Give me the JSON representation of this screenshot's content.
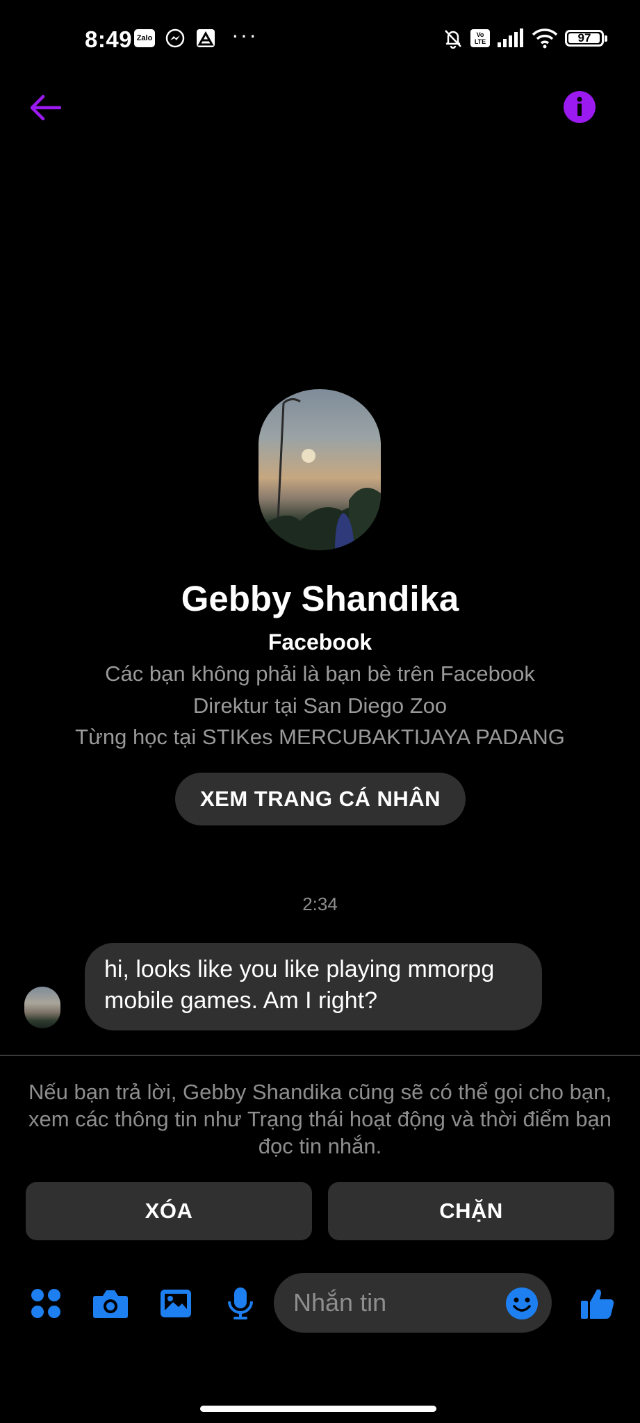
{
  "colors": {
    "accent_purple": "#9B1AF0",
    "accent_blue": "#1E7FF0",
    "bubble_bg": "#303030",
    "muted_text": "#8E8E8E"
  },
  "status_bar": {
    "time": "8:49",
    "left_icons": [
      "zalo-icon",
      "messenger-icon",
      "app-icon",
      "more-dots-icon"
    ],
    "zalo_text": "Zalo",
    "dots": "···",
    "right_icons": [
      "notifications-off-icon",
      "volte-icon",
      "signal-icon",
      "wifi-icon",
      "battery-icon"
    ],
    "volte_text": "Vo LTE",
    "battery": "97",
    "battery_level": 0.97
  },
  "nav": {
    "back_icon": "back-arrow-icon",
    "info_icon": "info-icon"
  },
  "profile": {
    "name": "Gebby Shandika",
    "source": "Facebook",
    "friend_status": "Các bạn không phải là bạn bè trên Facebook",
    "work": "Direktur tại San Diego Zoo",
    "education": "Từng học tại STIKes MERCUBAKTIJAYA PADANG",
    "view_profile_label": "XEM TRANG CÁ NHÂN"
  },
  "chat": {
    "timestamp": "2:34",
    "messages": [
      {
        "text": "hi, looks like you like playing mmorpg mobile games. Am I right?"
      }
    ]
  },
  "request": {
    "notice": "Nếu bạn trả lời, Gebby Shandika cũng sẽ có thể gọi cho bạn, xem các thông tin như Trạng thái hoạt động và thời điểm bạn đọc tin nhắn.",
    "delete_label": "XÓA",
    "block_label": "CHẶN"
  },
  "composer": {
    "icons": [
      "apps-icon",
      "camera-icon",
      "gallery-icon",
      "microphone-icon",
      "emoji-icon",
      "like-icon"
    ],
    "placeholder": "Nhắn tin"
  }
}
